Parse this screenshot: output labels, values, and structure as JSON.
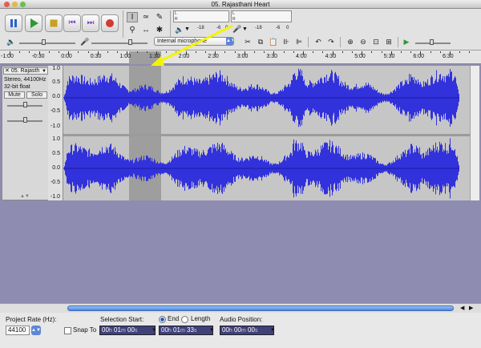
{
  "window": {
    "title": "05. Rajasthani Heart"
  },
  "toolbar": {
    "transport": [
      {
        "name": "pause-button",
        "icon": "pause-icon"
      },
      {
        "name": "play-button",
        "icon": "play-icon"
      },
      {
        "name": "stop-button",
        "icon": "stop-icon"
      },
      {
        "name": "skip-start-button",
        "icon": "skip-start-icon"
      },
      {
        "name": "skip-end-button",
        "icon": "skip-end-icon"
      },
      {
        "name": "record-button",
        "icon": "record-icon"
      }
    ],
    "tools": [
      {
        "name": "selection-tool",
        "glyph": "I",
        "selected": true
      },
      {
        "name": "envelope-tool",
        "glyph": "≃",
        "selected": false
      },
      {
        "name": "draw-tool",
        "glyph": "✎",
        "selected": false
      },
      {
        "name": "zoom-tool",
        "glyph": "⚲",
        "selected": false
      },
      {
        "name": "timeshift-tool",
        "glyph": "↔",
        "selected": false
      },
      {
        "name": "multi-tool",
        "glyph": "✱",
        "selected": false
      }
    ],
    "meter_channels": [
      "L",
      "R"
    ],
    "playback_scale": [
      "-18",
      "-6",
      "0"
    ],
    "record_scale": [
      "-18",
      "-6",
      "0"
    ],
    "input_source": "Internal microphone",
    "edit_buttons": [
      "cut-icon",
      "copy-icon",
      "paste-icon",
      "trim-icon",
      "silence-icon",
      "undo-icon",
      "redo-icon",
      "zoom-in-icon",
      "zoom-out-icon",
      "fit-selection-icon",
      "fit-project-icon"
    ]
  },
  "ruler": {
    "labels": [
      "-1:00",
      "-0:30",
      "0:00",
      "0:30",
      "1:00",
      "1:30",
      "2:00",
      "2:30",
      "3:00",
      "3:30",
      "4:00",
      "4:30",
      "5:00",
      "5:30",
      "6:00",
      "6:30"
    ]
  },
  "track": {
    "name": "05. Rajasth",
    "info_line1": "Stereo, 44100Hz",
    "info_line2": "32-bit float",
    "mute_label": "Mute",
    "solo_label": "Solo",
    "vruler_labels": [
      "1.0",
      "0.5",
      "0.0",
      "-0.5",
      "-1.0"
    ]
  },
  "selection_bar": {
    "project_rate_label": "Project Rate (Hz):",
    "project_rate_value": "44100",
    "snap_to_label": "Snap To",
    "selection_start_label": "Selection Start:",
    "end_label": "End",
    "length_label": "Length",
    "audio_position_label": "Audio Position:",
    "selection_start": [
      "00",
      "h",
      "01",
      "m",
      "00",
      "s"
    ],
    "selection_end": [
      "00",
      "h",
      "01",
      "m",
      "33",
      "s"
    ],
    "audio_position": [
      "00",
      "h",
      "00",
      "m",
      "00",
      "s"
    ]
  },
  "colors": {
    "waveform": "#3232dc",
    "track_bg": "#c6c6c6",
    "selection": "#9e9e9e",
    "annotation_arrow": "#f4f400"
  }
}
